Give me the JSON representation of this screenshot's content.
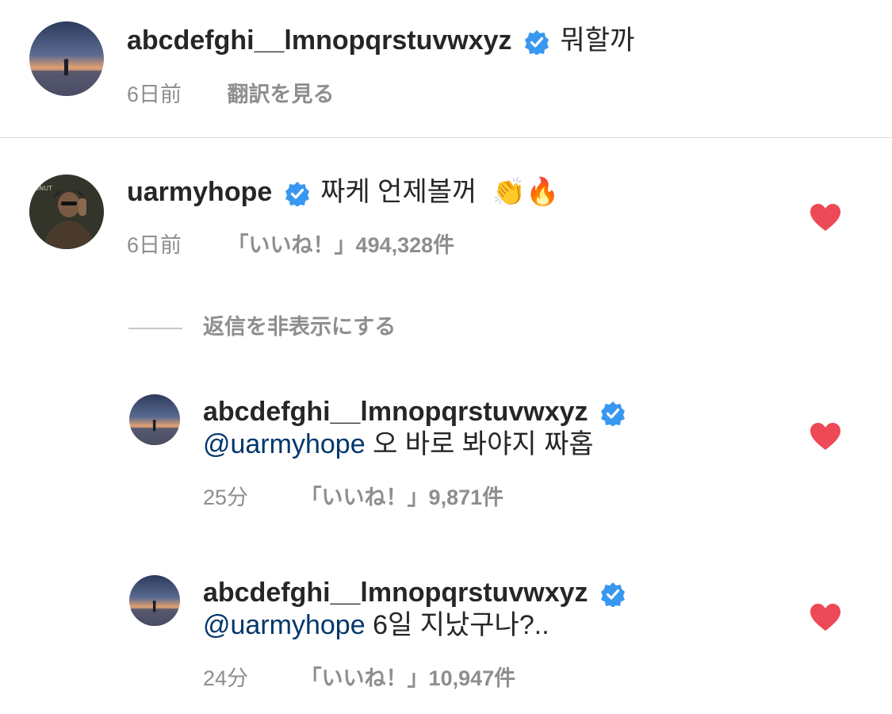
{
  "caption": {
    "username": "abcdefghi__lmnopqrstuvwxyz",
    "text": "뭐할까",
    "time": "6日前",
    "translate_label": "翻訳を見る"
  },
  "comments": [
    {
      "username": "uarmyhope",
      "text": "짜케 언제볼꺼",
      "emoji": "👏🔥",
      "time": "6日前",
      "likes": "「いいね！」494,328件"
    }
  ],
  "hide_replies_label": "返信を非表示にする",
  "replies": [
    {
      "username": "abcdefghi__lmnopqrstuvwxyz",
      "mention": "@uarmyhope",
      "text": "오 바로 봐야지 짜홉",
      "time": "25分",
      "likes": "「いいね！」9,871件"
    },
    {
      "username": "abcdefghi__lmnopqrstuvwxyz",
      "mention": "@uarmyhope",
      "text": "6일 지났구나?..",
      "time": "24分",
      "likes": "「いいね！」10,947件"
    }
  ],
  "icons": {
    "verified": "verified-badge-icon",
    "like": "heart-icon"
  },
  "colors": {
    "verified_blue": "#3897f0",
    "heart_red": "#ed4956",
    "mention": "#00376b",
    "meta_gray": "#8e8e8e"
  }
}
